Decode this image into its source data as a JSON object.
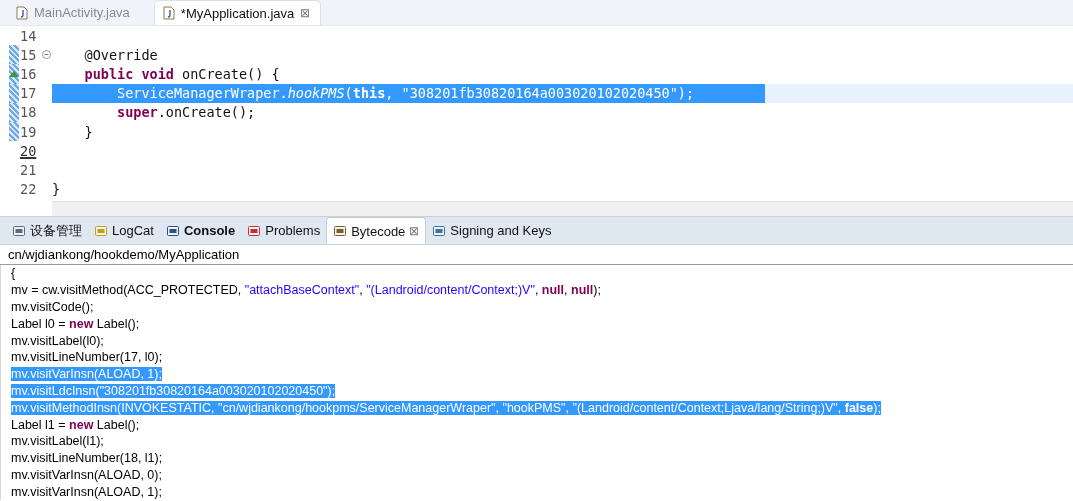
{
  "editor_tabs": [
    {
      "label": "MainActivity.java",
      "selected": false
    },
    {
      "label": "*MyApplication.java",
      "selected": true,
      "close": "⊠"
    }
  ],
  "editor": {
    "lines": [
      {
        "number": "14",
        "changed": false,
        "kind": "plain",
        "selected": false
      },
      {
        "number": "15",
        "changed": true,
        "kind": "fold",
        "selected": false,
        "tokens": [
          {
            "kind": "plain",
            "text": "    @Override"
          }
        ]
      },
      {
        "number": "16",
        "changed": true,
        "kind": "override",
        "selected": false,
        "tokens": [
          {
            "kind": "keyword",
            "text": "    public "
          },
          {
            "kind": "keyword",
            "text": "void"
          },
          {
            "kind": "plain",
            "text": " onCreate() {"
          }
        ]
      },
      {
        "number": "17",
        "changed": true,
        "kind": "plain",
        "selected": true,
        "tokens": [
          {
            "kind": "plain",
            "text": "        ServiceManagerWraper."
          },
          {
            "kind": "italic",
            "text": "hookPMS"
          },
          {
            "kind": "plain",
            "text": "("
          },
          {
            "kind": "keyword",
            "text": "this"
          },
          {
            "kind": "plain",
            "text": ", \"308201fb30820164a003020102020450\");"
          }
        ]
      },
      {
        "number": "18",
        "changed": true,
        "kind": "plain",
        "selected": false,
        "tokens": [
          {
            "kind": "keyword",
            "text": "        super"
          },
          {
            "kind": "plain",
            "text": ".onCreate();"
          }
        ]
      },
      {
        "number": "19",
        "changed": true,
        "kind": "plain",
        "selected": false,
        "tokens": [
          {
            "kind": "plain",
            "text": "    }"
          }
        ]
      },
      {
        "number": "20",
        "changed": false,
        "kind": "current",
        "selected": false
      },
      {
        "number": "21",
        "changed": false,
        "kind": "plain",
        "selected": false
      },
      {
        "number": "22",
        "changed": false,
        "kind": "plain",
        "selected": false,
        "tokens": [
          {
            "kind": "plain",
            "text": "}"
          }
        ]
      }
    ]
  },
  "panel_tabs": [
    {
      "label": "设备管理",
      "selected": false,
      "bold": false
    },
    {
      "label": "LogCat",
      "selected": false,
      "bold": false
    },
    {
      "label": "Console",
      "selected": false,
      "bold": true
    },
    {
      "label": "Problems",
      "selected": false,
      "bold": false
    },
    {
      "label": "Bytecode",
      "selected": true,
      "bold": false,
      "close": "⊠"
    },
    {
      "label": "Signing and Keys",
      "selected": false,
      "bold": false
    }
  ],
  "bytecode": {
    "path": "cn/wjdiankong/hookdemo/MyApplication",
    "lines": [
      {
        "selected": false,
        "tokens": [
          {
            "kind": "plain",
            "text": "{"
          }
        ]
      },
      {
        "selected": false,
        "tokens": [
          {
            "kind": "plain",
            "text": "mv = cw.visitMethod(ACC_PROTECTED, "
          },
          {
            "kind": "string",
            "text": "\"attachBaseContext\""
          },
          {
            "kind": "plain",
            "text": ", "
          },
          {
            "kind": "string",
            "text": "\"(Landroid/content/Context;)V\""
          },
          {
            "kind": "plain",
            "text": ", "
          },
          {
            "kind": "keyword",
            "text": "null"
          },
          {
            "kind": "plain",
            "text": ", "
          },
          {
            "kind": "keyword",
            "text": "null"
          },
          {
            "kind": "plain",
            "text": ");"
          }
        ]
      },
      {
        "selected": false,
        "tokens": [
          {
            "kind": "plain",
            "text": "mv.visitCode();"
          }
        ]
      },
      {
        "selected": false,
        "tokens": [
          {
            "kind": "plain",
            "text": "Label l0 = "
          },
          {
            "kind": "keyword",
            "text": "new"
          },
          {
            "kind": "plain",
            "text": " Label();"
          }
        ]
      },
      {
        "selected": false,
        "tokens": [
          {
            "kind": "plain",
            "text": "mv.visitLabel(l0);"
          }
        ]
      },
      {
        "selected": false,
        "tokens": [
          {
            "kind": "plain",
            "text": "mv.visitLineNumber(17, l0);"
          }
        ]
      },
      {
        "selected": true,
        "tokens": [
          {
            "kind": "plain",
            "text": "mv.visitVarInsn(ALOAD, 1);"
          }
        ]
      },
      {
        "selected": true,
        "tokens": [
          {
            "kind": "plain",
            "text": "mv.visitLdcInsn("
          },
          {
            "kind": "string",
            "text": "\"308201fb30820164a003020102020450\""
          },
          {
            "kind": "plain",
            "text": ");"
          }
        ]
      },
      {
        "selected": true,
        "tokens": [
          {
            "kind": "plain",
            "text": "mv.visitMethodInsn(INVOKESTATIC, "
          },
          {
            "kind": "string",
            "text": "\"cn/wjdiankong/hookpms/ServiceManagerWraper\""
          },
          {
            "kind": "plain",
            "text": ", "
          },
          {
            "kind": "string",
            "text": "\"hookPMS\""
          },
          {
            "kind": "plain",
            "text": ", "
          },
          {
            "kind": "string",
            "text": "\"(Landroid/content/Context;Ljava/lang/String;)V\""
          },
          {
            "kind": "plain",
            "text": ", "
          },
          {
            "kind": "keyword",
            "text": "false"
          },
          {
            "kind": "plain",
            "text": ");"
          }
        ]
      },
      {
        "selected": false,
        "tokens": [
          {
            "kind": "plain",
            "text": "Label l1 = "
          },
          {
            "kind": "keyword",
            "text": "new"
          },
          {
            "kind": "plain",
            "text": " Label();"
          }
        ]
      },
      {
        "selected": false,
        "tokens": [
          {
            "kind": "plain",
            "text": "mv.visitLabel(l1);"
          }
        ]
      },
      {
        "selected": false,
        "tokens": [
          {
            "kind": "plain",
            "text": "mv.visitLineNumber(18, l1);"
          }
        ]
      },
      {
        "selected": false,
        "tokens": [
          {
            "kind": "plain",
            "text": "mv.visitVarInsn(ALOAD, 0);"
          }
        ]
      },
      {
        "selected": false,
        "tokens": [
          {
            "kind": "plain",
            "text": "mv.visitVarInsn(ALOAD, 1);"
          }
        ]
      }
    ]
  }
}
